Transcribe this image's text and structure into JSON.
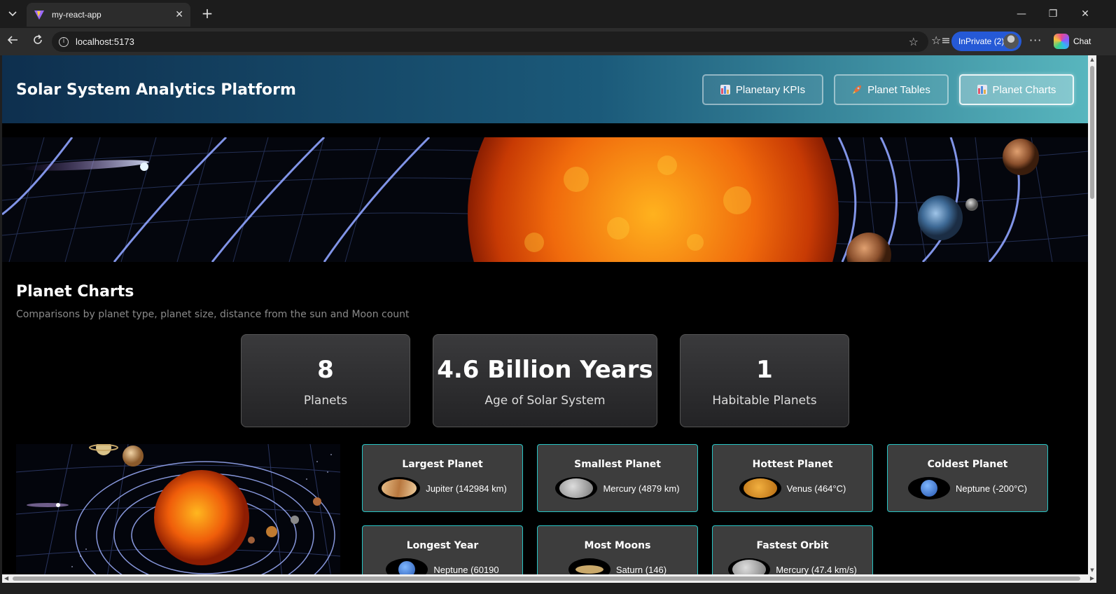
{
  "browser": {
    "tab_title": "my-react-app",
    "url": "localhost:5173",
    "inprivate_label": "InPrivate (2)",
    "chat_label": "Chat"
  },
  "header": {
    "title": "Solar System Analytics Platform",
    "nav": [
      {
        "label": "Planetary KPIs",
        "icon": "bar-chart-icon"
      },
      {
        "label": "Planet Tables",
        "icon": "rocket-icon"
      },
      {
        "label": "Planet Charts",
        "icon": "bar-chart-icon",
        "active": true
      }
    ]
  },
  "section": {
    "title": "Planet Charts",
    "subtitle": "Comparisons by planet type, planet size, distance from the sun and Moon count"
  },
  "stats": [
    {
      "value": "8",
      "label": "Planets"
    },
    {
      "value": "4.6 Billion Years",
      "label": "Age of Solar System"
    },
    {
      "value": "1",
      "label": "Habitable Planets"
    }
  ],
  "facts": [
    {
      "title": "Largest Planet",
      "value": "Jupiter (142984 km)",
      "planet_color": "#c9955a"
    },
    {
      "title": "Smallest Planet",
      "value": "Mercury (4879 km)",
      "planet_color": "#9a9a9a"
    },
    {
      "title": "Hottest Planet",
      "value": "Venus (464°C)",
      "planet_color": "#d88a2a"
    },
    {
      "title": "Coldest Planet",
      "value": "Neptune (-200°C)",
      "planet_color": "#3b7fe0"
    },
    {
      "title": "Longest Year",
      "value": "Neptune (60190",
      "planet_color": "#3b7fe0"
    },
    {
      "title": "Most Moons",
      "value": "Saturn (146)",
      "planet_color": "#c9a86a"
    },
    {
      "title": "Fastest Orbit",
      "value": "Mercury (47.4 km/s)",
      "planet_color": "#9a9a9a"
    }
  ],
  "colors": {
    "accent_border": "#27c4c4",
    "header_start": "#0e2f4e",
    "header_end": "#58b6be",
    "card_bg": "#3d3d3d"
  }
}
